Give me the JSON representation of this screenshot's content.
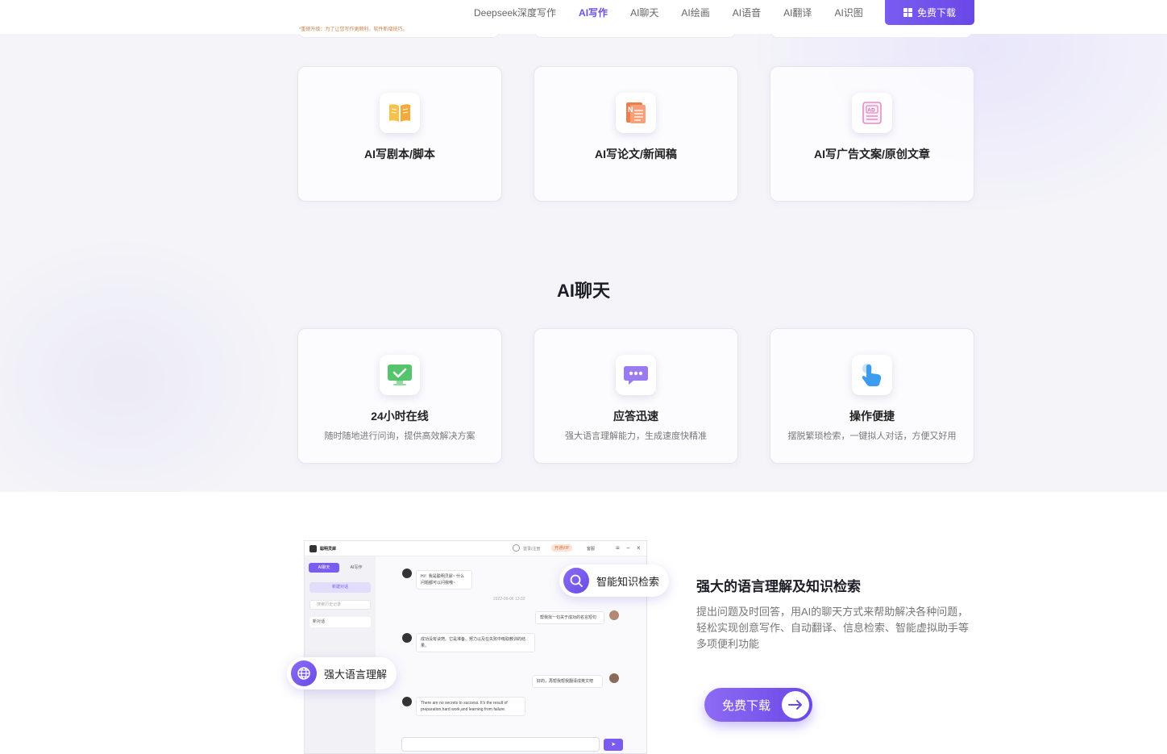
{
  "nav": {
    "links": [
      "Deepseek深度写作",
      "AI写作",
      "AI聊天",
      "AI绘画",
      "AI语音",
      "AI翻译",
      "AI识图"
    ],
    "active_index": 1,
    "download_label": "免费下载",
    "notice": "*重磅升级：为了让您写作更顺利，软件新增技巧。"
  },
  "writing_cards": [
    {
      "title": "AI写剧本/脚本",
      "icon": "book-icon"
    },
    {
      "title": "AI写论文/新闻稿",
      "icon": "news-icon"
    },
    {
      "title": "AI写广告文案/原创文章",
      "icon": "ad-document-icon"
    }
  ],
  "chat_section": {
    "title": "AI聊天",
    "cards": [
      {
        "title": "24小时在线",
        "desc": "随时随地进行问询，提供高效解决方案",
        "icon": "monitor-check-icon"
      },
      {
        "title": "应答迅速",
        "desc": "强大语言理解能力，生成速度快精准",
        "icon": "chat-bubble-icon"
      },
      {
        "title": "操作便捷",
        "desc": "摆脱繁琐检索，一键拟人对话，方便又好用",
        "icon": "hand-pointer-icon"
      }
    ]
  },
  "feature": {
    "title": "强大的语言理解及知识检索",
    "desc": "提出问题及时回答，用AI的聊天方式来帮助解决各种问题，轻松实现创意写作、自动翻译、信息检索、智能虚拟助手等多项便利功能",
    "cta_label": "免费下载",
    "pill_knowledge": "智能知识检索",
    "pill_language": "强大语言理解"
  },
  "mock": {
    "app_name": "聪明灵犀",
    "login": "登录/注册",
    "vip": "开通VIP",
    "service": "客服",
    "tab_chat": "AI聊天",
    "tab_write": "AI写作",
    "new_chat": "新建对话",
    "search_placeholder": "搜索历史记录",
    "history_item": "新对话",
    "msg1": "Hi！我是聪明灵犀~ 什么问题都可以问我哦~",
    "time": "2022-09-06 13:32",
    "user1": "帮我找一句关于成功的名言短句",
    "msg2": "成功没有诀窍。它是准备、努力以及在失败中吸取教训的结果。",
    "user2": "好的，再帮我帮我翻译成英文吧",
    "msg3": "There are no secrets to success. It's the result of preparation,hard work,and learning from failure."
  },
  "colors": {
    "accent": "#6b4fe6",
    "accent_light": "#8d6bf4"
  }
}
